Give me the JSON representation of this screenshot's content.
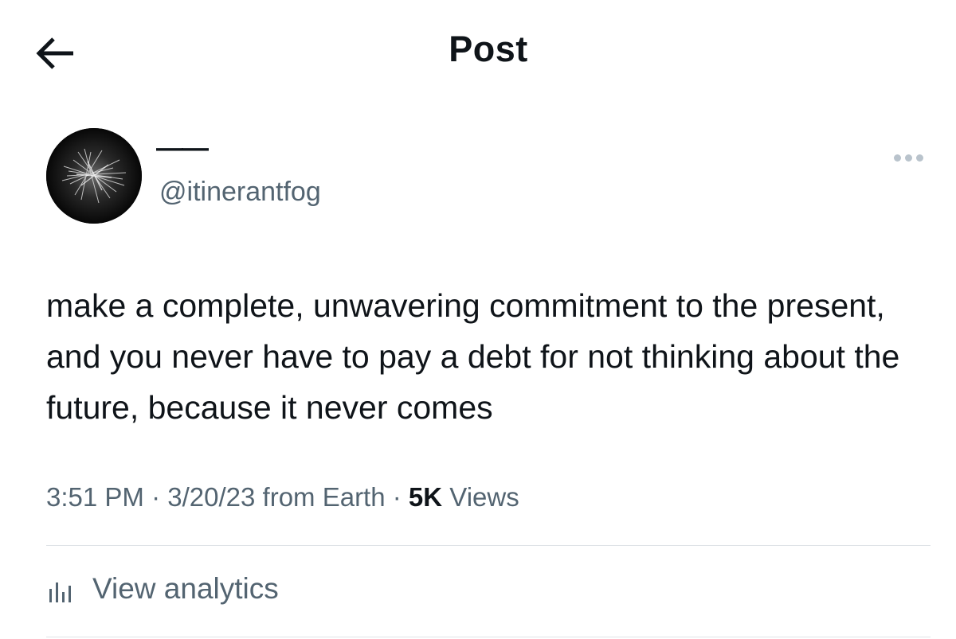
{
  "header": {
    "title": "Post",
    "back_icon": "arrow-left-icon"
  },
  "author": {
    "display_name": "——",
    "handle": "@itinerantfog",
    "avatar": "abstract-avatar"
  },
  "post": {
    "text": "make a complete, unwavering commitment to the present, and you never have to pay a debt for not thinking about the future, because it never comes",
    "time": "3:51 PM",
    "separator": "·",
    "date": "3/20/23",
    "source": "from Earth",
    "views_count": "5K",
    "views_label": "Views"
  },
  "actions": {
    "more_icon": "more-horizontal-icon",
    "analytics_label": "View analytics",
    "analytics_icon": "bar-chart-icon"
  },
  "colors": {
    "text_primary": "#0f1419",
    "text_secondary": "#536471",
    "divider": "#dfe3e7",
    "more_dots": "#b9c3cc"
  }
}
